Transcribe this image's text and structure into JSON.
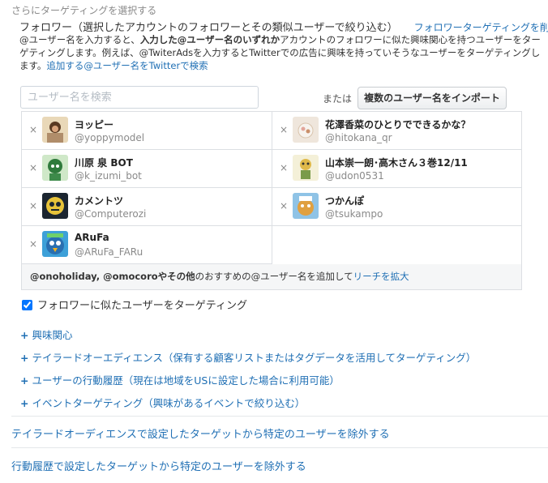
{
  "section_label": "さらにターゲティングを選択する",
  "follower": {
    "title": "フォロワー（選択したアカウントのフォロワーとその類似ユーザーで絞り込む）",
    "remove_link": "フォロワーターゲティングを削除"
  },
  "description": {
    "part1": "@ユーザー名を入力すると、",
    "bold": "入力した@ユーザー名のいずれか",
    "part2": "アカウントのフォロワーに似た興味関心を持つユーザーをターゲティングします。例えば、@TwiterAdsを入力するとTwitterでの広告に興味を持っていそうなユーザーをターゲティングします。",
    "link": "追加する@ユーザー名をTwitterで検索"
  },
  "search": {
    "placeholder": "ユーザー名を検索",
    "value": ""
  },
  "or_label": "または",
  "import_button": "複数のユーザー名をインポート",
  "accounts": [
    {
      "name": "ヨッピー",
      "handle": "@yoppymodel"
    },
    {
      "name": "花澤香菜のひとりでできるかな？",
      "handle": "@hitokana_qr"
    },
    {
      "name": "川原 泉 BOT",
      "handle": "@k_izumi_bot"
    },
    {
      "name": "山本崇一朗･高木さん３巻12/11",
      "handle": "@udon0531"
    },
    {
      "name": "カメントツ",
      "handle": "@Computerozi"
    },
    {
      "name": "つかんぽ",
      "handle": "@tsukampo"
    },
    {
      "name": "ARuFa",
      "handle": "@ARuFa_FARu"
    }
  ],
  "remove_symbol": "×",
  "suggestion": {
    "names": "@onoholiday, @omocoro",
    "and_others": "やその他",
    "middle": "のおすすめの@ユーザー名を追加して",
    "link": "リーチを拡大"
  },
  "similar_checkbox": {
    "label": "フォロワーに似たユーザーをターゲティング",
    "checked": true
  },
  "expand_options": [
    {
      "symbol": "+",
      "label": "興味関心"
    },
    {
      "symbol": "+",
      "label": "テイラードオーエディエンス（保有する顧客リストまたはタグデータを活用してターゲティング）"
    },
    {
      "symbol": "+",
      "label": "ユーザーの行動履歴（現在は地域をUSに設定した場合に利用可能）"
    },
    {
      "symbol": "+",
      "label": "イベントターゲティング（興味があるイベントで絞り込む）"
    }
  ],
  "exclude_links": [
    "テイラードオーディエンスで設定したターゲットから特定のユーザーを除外する",
    "行動履歴で設定したターゲットから特定のユーザーを除外する"
  ],
  "colors": {
    "link": "#1f6fb4",
    "border": "#dcdfe3",
    "suggest_bg": "#f5f6f7"
  }
}
